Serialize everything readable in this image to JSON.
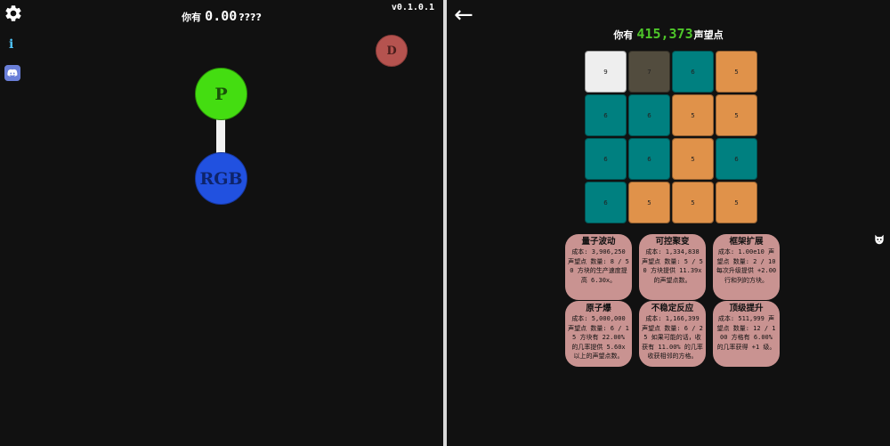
{
  "left": {
    "currency_prefix": "你有",
    "currency_value": "0.00",
    "currency_suffix": "????",
    "version": "v0.1.0.1",
    "info_label": "i",
    "nodes": {
      "p": {
        "label": "P",
        "color": "#44dd11"
      },
      "rgb": {
        "label": "RGB",
        "color": "#2151e0"
      },
      "d": {
        "label": "D",
        "color": "#b5534f"
      }
    },
    "icons": [
      "gear-icon",
      "info-icon",
      "discord-icon"
    ]
  },
  "right": {
    "back_label": "←",
    "prestige_prefix": "你有",
    "prestige_value": "415,373",
    "prestige_suffix": "声望点",
    "grid_colors": {
      "white": "#eeeeee",
      "dark": "#524c3e",
      "teal": "#008080",
      "orange": "#e0924a"
    },
    "grid": [
      [
        {
          "v": "9",
          "c": "white"
        },
        {
          "v": "7",
          "c": "dark"
        },
        {
          "v": "6",
          "c": "teal"
        },
        {
          "v": "5",
          "c": "orange"
        }
      ],
      [
        {
          "v": "6",
          "c": "teal"
        },
        {
          "v": "6",
          "c": "teal"
        },
        {
          "v": "5",
          "c": "orange"
        },
        {
          "v": "5",
          "c": "orange"
        }
      ],
      [
        {
          "v": "6",
          "c": "teal"
        },
        {
          "v": "6",
          "c": "teal"
        },
        {
          "v": "5",
          "c": "orange"
        },
        {
          "v": "6",
          "c": "teal"
        }
      ],
      [
        {
          "v": "6",
          "c": "teal"
        },
        {
          "v": "5",
          "c": "orange"
        },
        {
          "v": "5",
          "c": "orange"
        },
        {
          "v": "5",
          "c": "orange"
        }
      ]
    ],
    "upgrades": [
      {
        "title": "量子波动",
        "desc": "成本: 3,906,250 声望点 数量: 8 / 50 方块的生产速度提高 6.30x。"
      },
      {
        "title": "可控聚变",
        "desc": "成本: 1,334,838 声望点 数量: 5 / 50 方块提供 11.39x 的声望点数。"
      },
      {
        "title": "框架扩展",
        "desc": "成本: 1.00e10 声望点 数量: 2 / 10 每次升级提供 +2.00 行和列的方块。"
      },
      {
        "title": "原子爆",
        "desc": "成本: 5,000,000 声望点 数量: 6 / 15 方块有 22.00% 的几率提供 5.60x 以上的声望点数。"
      },
      {
        "title": "不稳定反应",
        "desc": "成本: 1,166,399 声望点 数量: 6 / 25 如果可能的话，收获有 11.00% 的几率 收获相邻的方格。"
      },
      {
        "title": "顶级提升",
        "desc": "成本: 511,999 声望点 数量: 12 / 100 方格有 6.00% 的几率获得 +1 级。"
      }
    ],
    "side_icon": "cat-icon"
  }
}
